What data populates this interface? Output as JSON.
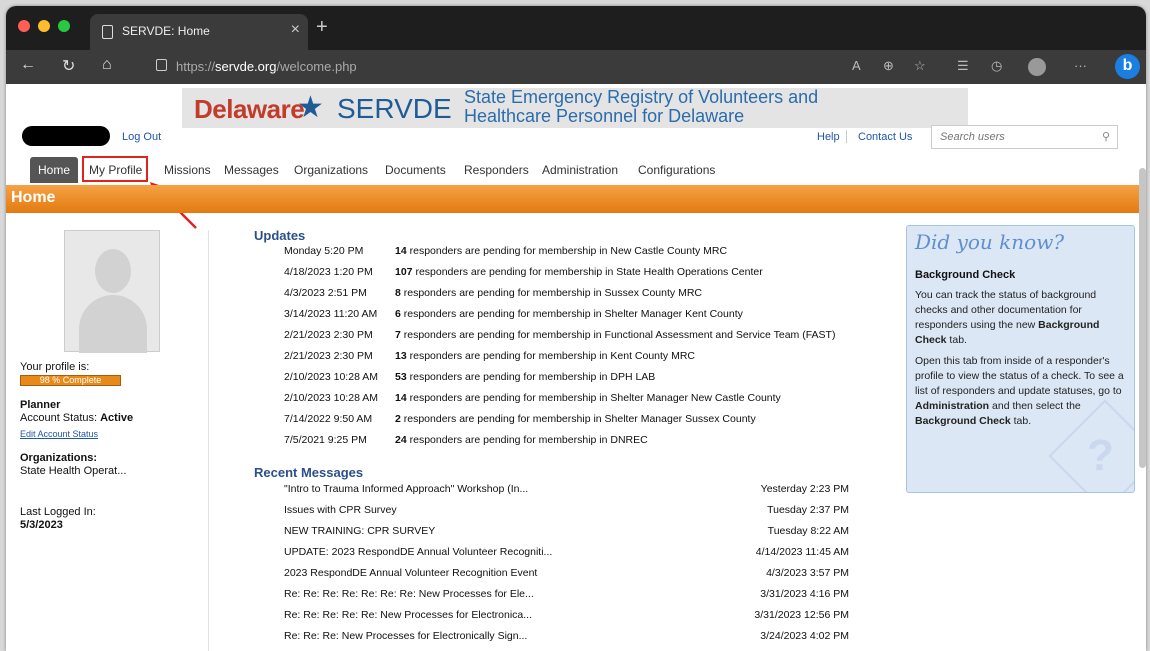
{
  "browser": {
    "tab_title": "SERVDE: Home",
    "url_prefix": "https://",
    "url_host": "servde.org",
    "url_path": "/welcome.php",
    "icons": [
      "back-icon",
      "reload-icon",
      "home-icon",
      "lock-icon",
      "read-aloud-icon",
      "zoom-icon",
      "favorite-icon",
      "favorites-icon",
      "history-icon",
      "profile-icon",
      "more-icon",
      "bing-icon"
    ]
  },
  "banner": {
    "state": "Delaware",
    "brand": "SERVDE",
    "subtitle_line1": "State Emergency Registry of Volunteers and",
    "subtitle_line2": "Healthcare Personnel for Delaware"
  },
  "header": {
    "logout": "Log Out",
    "help": "Help",
    "contact": "Contact Us",
    "search_placeholder": "Search users"
  },
  "menu": [
    "Home",
    "My Profile",
    "Missions",
    "Messages",
    "Organizations",
    "Documents",
    "Responders",
    "Administration",
    "Configurations"
  ],
  "page_title": "Home",
  "profile": {
    "label": "Your profile is:",
    "completeness": "98 % Complete",
    "role": "Planner",
    "status_label": "Account Status:",
    "status_value": "Active",
    "edit_link": "Edit Account Status",
    "orgs_label": "Organizations:",
    "orgs_value": "State Health Operat...",
    "last_label": "Last Logged In:",
    "last_value": "5/3/2023"
  },
  "updates_title": "Updates",
  "updates": [
    {
      "when": "Monday 5:20 PM",
      "count": "14",
      "text": " responders are pending for membership in New Castle County MRC"
    },
    {
      "when": "4/18/2023 1:20 PM",
      "count": "107",
      "text": " responders are pending for membership in State Health Operations Center"
    },
    {
      "when": "4/3/2023 2:51 PM",
      "count": "8",
      "text": " responders are pending for membership in Sussex County MRC"
    },
    {
      "when": "3/14/2023 11:20 AM",
      "count": "6",
      "text": " responders are pending for membership in Shelter Manager Kent County"
    },
    {
      "when": "2/21/2023 2:30 PM",
      "count": "7",
      "text": " responders are pending for membership in Functional Assessment and Service Team (FAST)"
    },
    {
      "when": "2/21/2023 2:30 PM",
      "count": "13",
      "text": " responders are pending for membership in Kent County MRC"
    },
    {
      "when": "2/10/2023 10:28 AM",
      "count": "53",
      "text": " responders are pending for membership in DPH LAB"
    },
    {
      "when": "2/10/2023 10:28 AM",
      "count": "14",
      "text": " responders are pending for membership in Shelter Manager New Castle County"
    },
    {
      "when": "7/14/2022 9:50 AM",
      "count": "2",
      "text": " responders are pending for membership in Shelter Manager Sussex County"
    },
    {
      "when": "7/5/2021 9:25 PM",
      "count": "24",
      "text": " responders are pending for membership in DNREC"
    }
  ],
  "messages_title": "Recent Messages",
  "messages": [
    {
      "subject": "\"Intro to Trauma Informed Approach\" Workshop (In...",
      "time": "Yesterday 2:23 PM"
    },
    {
      "subject": "Issues with CPR Survey",
      "time": "Tuesday 2:37 PM"
    },
    {
      "subject": "NEW TRAINING: CPR SURVEY",
      "time": "Tuesday 8:22 AM"
    },
    {
      "subject": "UPDATE: 2023 RespondDE Annual Volunteer Recogniti...",
      "time": "4/14/2023 11:45 AM"
    },
    {
      "subject": "2023 RespondDE Annual Volunteer Recognition Event",
      "time": "4/3/2023 3:57 PM"
    },
    {
      "subject": "Re: Re: Re: Re: Re: Re: Re: New Processes for Ele...",
      "time": "3/31/2023 4:16 PM"
    },
    {
      "subject": "Re: Re: Re: Re: Re: New Processes for Electronica...",
      "time": "3/31/2023 12:56 PM"
    },
    {
      "subject": "Re: Re: Re: New Processes for Electronically Sign...",
      "time": "3/24/2023 4:02 PM"
    }
  ],
  "did_you_know": {
    "title": "Did you know?",
    "heading": "Background Check",
    "p1_a": "You can track the status of background checks and other documentation for responders using the new ",
    "p1_b": "Background Check",
    "p1_c": " tab.",
    "p2_a": "Open this tab from inside of a responder's profile to view the status of a check. To see a list of responders and update statuses, go to ",
    "p2_b": "Administration",
    "p2_c": " and then select the ",
    "p2_d": "Background Check",
    "p2_e": " tab."
  }
}
